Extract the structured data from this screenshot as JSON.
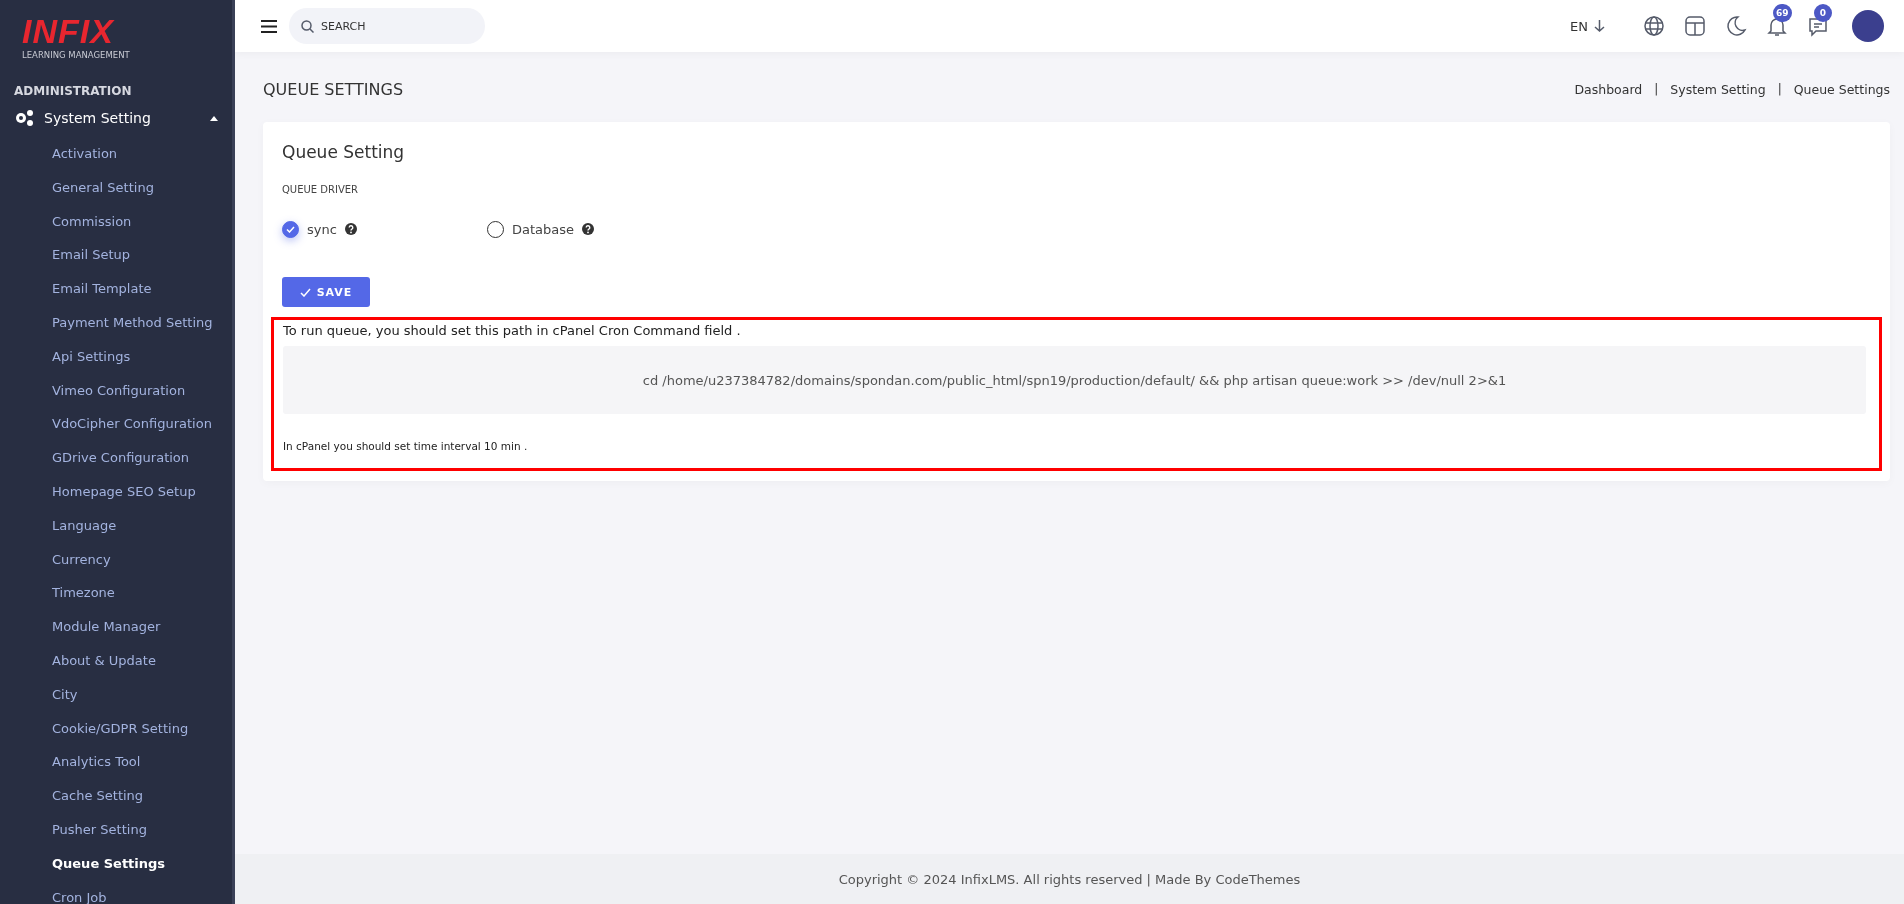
{
  "logo": {
    "brand": "INFIX",
    "tagline": "LEARNING MANAGEMENT"
  },
  "sidebar": {
    "section": "ADMINISTRATION",
    "group": {
      "label": "System Setting",
      "expanded": true
    },
    "items": [
      {
        "label": "Activation",
        "selected": false
      },
      {
        "label": "General Setting",
        "selected": false
      },
      {
        "label": "Commission",
        "selected": false
      },
      {
        "label": "Email Setup",
        "selected": false
      },
      {
        "label": "Email Template",
        "selected": false
      },
      {
        "label": "Payment Method Setting",
        "selected": false
      },
      {
        "label": "Api Settings",
        "selected": false
      },
      {
        "label": "Vimeo Configuration",
        "selected": false
      },
      {
        "label": "VdoCipher Configuration",
        "selected": false
      },
      {
        "label": "GDrive Configuration",
        "selected": false
      },
      {
        "label": "Homepage SEO Setup",
        "selected": false
      },
      {
        "label": "Language",
        "selected": false
      },
      {
        "label": "Currency",
        "selected": false
      },
      {
        "label": "Timezone",
        "selected": false
      },
      {
        "label": "Module Manager",
        "selected": false
      },
      {
        "label": "About & Update",
        "selected": false
      },
      {
        "label": "City",
        "selected": false
      },
      {
        "label": "Cookie/GDPR Setting",
        "selected": false
      },
      {
        "label": "Analytics Tool",
        "selected": false
      },
      {
        "label": "Cache Setting",
        "selected": false
      },
      {
        "label": "Pusher Setting",
        "selected": false
      },
      {
        "label": "Queue Settings",
        "selected": true
      },
      {
        "label": "Cron Job",
        "selected": false
      }
    ]
  },
  "topbar": {
    "search": {
      "placeholder": "SEARCH"
    },
    "language": "EN",
    "notifications": "69",
    "messages": "0"
  },
  "page": {
    "title": "QUEUE SETTINGS",
    "breadcrumb": [
      "Dashboard",
      "System Setting",
      "Queue Settings"
    ],
    "separator": "|"
  },
  "card": {
    "title": "Queue Setting",
    "field_label": "QUEUE DRIVER",
    "options": [
      {
        "label": "sync",
        "selected": true
      },
      {
        "label": "Database",
        "selected": false
      }
    ],
    "save_button": "SAVE",
    "note": {
      "heading": "To run queue, you should set this path in cPanel Cron Command field .",
      "command": "cd /home/u237384782/domains/spondan.com/public_html/spn19/production/default/ && php artisan queue:work >> /dev/null 2>&1",
      "footer": "In cPanel you should set time interval 10 min ."
    }
  },
  "footer": "Copyright © 2024 InfixLMS. All rights reserved | Made By CodeThemes"
}
